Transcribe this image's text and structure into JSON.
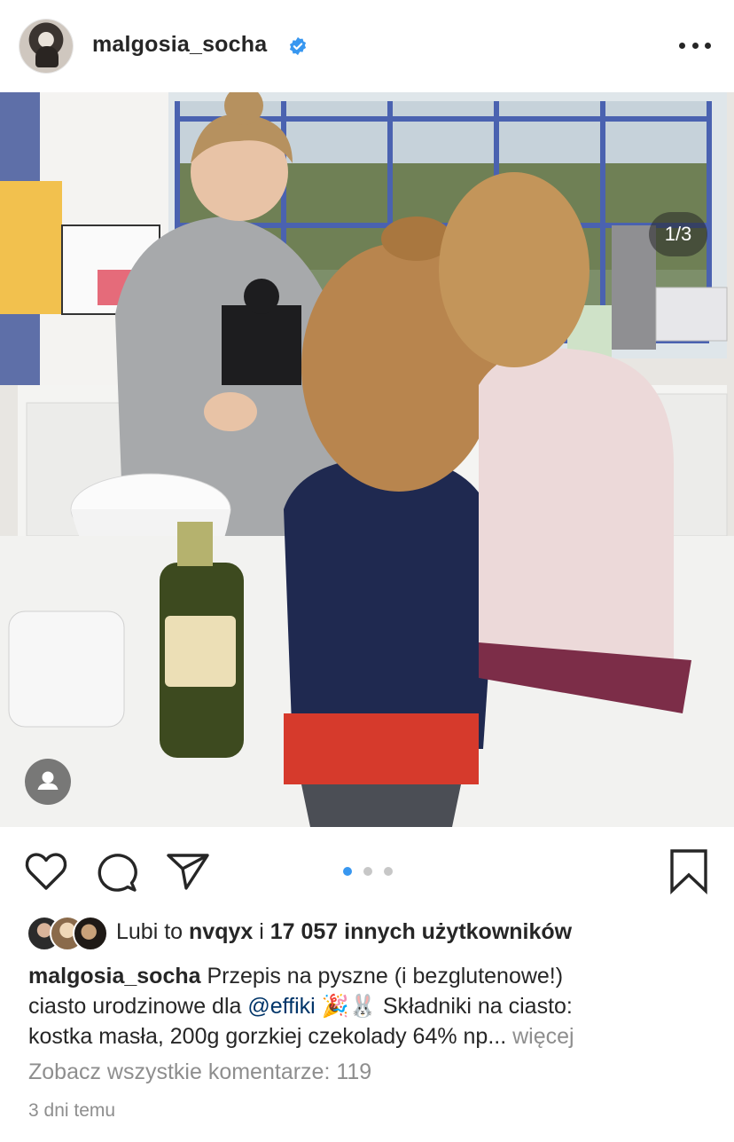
{
  "post": {
    "username": "malgosia_socha",
    "verified": true,
    "menu_icon": "more-horizontal-icon",
    "image_counter": "1/3",
    "carousel_total": 3,
    "carousel_current": 1
  },
  "likes": {
    "prefix": "Lubi to ",
    "user": "nvqyx",
    "middle": " i ",
    "count_text": "17 057 innych użytkowników"
  },
  "caption": {
    "username": "malgosia_socha",
    "line1": " Przepis na pyszne (i bezglutenowe!)",
    "line2_pre": "ciasto urodzinowe dla ",
    "mention": "@effiki",
    "emojis": " 🎉🐰 ",
    "line2_post": "Składniki na ciasto:",
    "line3": "kostka masła, 200g gorzkiej czekolady 64% np... ",
    "more_label": "więcej"
  },
  "comments_label": "Zobacz wszystkie komentarze: 119",
  "timestamp": "3 dni temu",
  "colors": {
    "text": "#262626",
    "muted": "#8e8e8e",
    "accent": "#3897f0",
    "verified": "#3897f0",
    "mention": "#003569"
  }
}
